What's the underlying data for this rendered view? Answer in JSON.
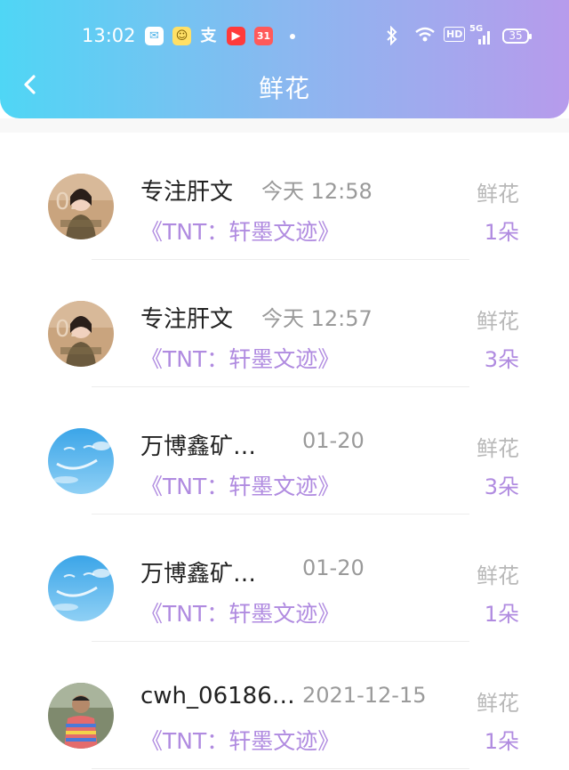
{
  "status_bar": {
    "time": "13:02",
    "notification_icons": [
      "mail-icon",
      "app-icon",
      "alipay-icon",
      "video-icon",
      "calendar-icon"
    ],
    "calendar_badge": "31",
    "hd": "HD",
    "network": "5G",
    "battery": "35"
  },
  "header": {
    "title": "鲜花"
  },
  "records": [
    {
      "name": "专注肝文",
      "time": "今天 12:58",
      "book": "《TNT：轩墨文迹》",
      "gift": "鲜花",
      "count": "1朵",
      "avatar": "portrait-woman"
    },
    {
      "name": "专注肝文",
      "time": "今天 12:57",
      "book": "《TNT：轩墨文迹》",
      "gift": "鲜花",
      "count": "3朵",
      "avatar": "portrait-woman"
    },
    {
      "name": "万博鑫矿…",
      "time": "01-20",
      "book": "《TNT：轩墨文迹》",
      "gift": "鲜花",
      "count": "3朵",
      "avatar": "sky-clouds"
    },
    {
      "name": "万博鑫矿…",
      "time": "01-20",
      "book": "《TNT：轩墨文迹》",
      "gift": "鲜花",
      "count": "1朵",
      "avatar": "sky-clouds"
    },
    {
      "name": "cwh_06186…",
      "time": "2021-12-15",
      "book": "《TNT：轩墨文迹》",
      "gift": "鲜花",
      "count": "1朵",
      "avatar": "portrait-man"
    }
  ],
  "colors": {
    "accent": "#b08be0",
    "header_start": "#4fd6f5",
    "header_end": "#b79bec"
  }
}
